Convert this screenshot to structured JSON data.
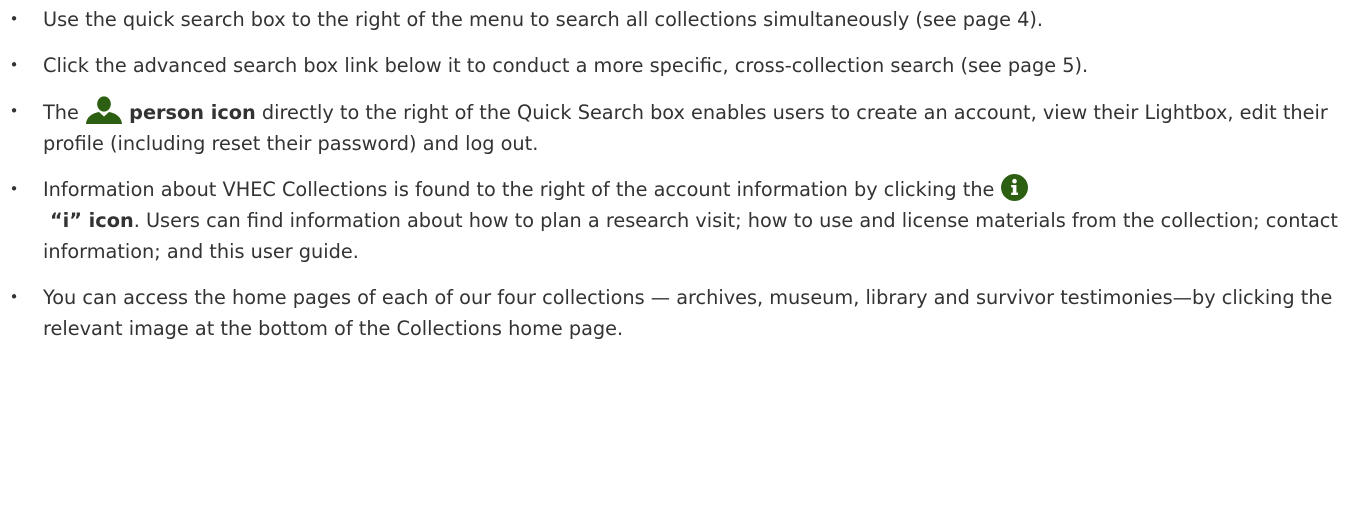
{
  "icon_color": "#2d5f12",
  "items": [
    {
      "text": "Use the quick search box to the right of the menu to search all collections simultaneously (see page 4)."
    },
    {
      "text": "Click the advanced search box link below it to conduct a more specific, cross-collection search (see page 5)."
    },
    {
      "pre": "The",
      "strong": "person icon",
      "post": " directly to the right of the Quick Search box enables users to create an account, view their Lightbox, edit their profile (including reset their password) and log out."
    },
    {
      "pre": "Information about VHEC Collections is found to the right of the account information by clicking the",
      "strong": "“i” icon",
      "post": ". Users can find information about how to plan a research visit; how to use and license materials from the collection; contact information; and this user guide."
    },
    {
      "text": "You can access the home pages of each of our four collections — archives, museum, library and survivor testimonies—by clicking the relevant image at the bottom of the Collections home page."
    }
  ]
}
